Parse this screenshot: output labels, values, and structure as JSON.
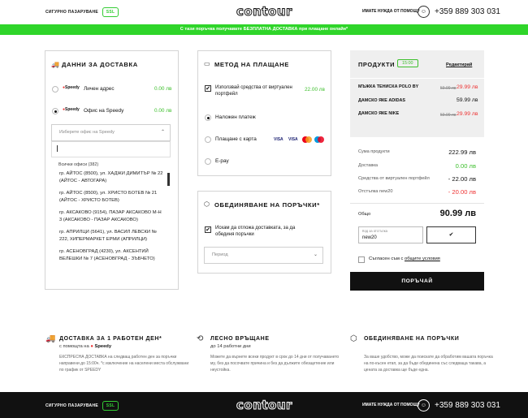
{
  "header": {
    "secure_label": "СИГУРНО ПАЗАРУВАНЕ",
    "secure_badge": "SSL",
    "logo": "contour",
    "help": "ИМАТЕ НУЖДА ОТ ПОМОЩ?",
    "phone": "+359 889 303 031"
  },
  "promo": "С тази поръчка получавате БЕЗПЛАТНА ДОСТАВКА при плащане онлайн*",
  "delivery": {
    "title": "ДАННИ ЗА ДОСТАВКА",
    "options": [
      {
        "carrier": "Speedy",
        "label": "Личен адрес",
        "price": "0.00 лв",
        "selected": false
      },
      {
        "carrier": "Speedy",
        "label": "Офис на Speedy",
        "price": "0.00 лв",
        "selected": true
      }
    ],
    "office_placeholder": "Изберете офис на Speedy",
    "all_offices": "Всички офиси (382)",
    "offices": [
      "гр. АЙТОС (8500), ул. ХАДЖИ ДИМИТЪР № 22 (АЙТОС - АВТОГАРА)",
      "гр. АЙТОС (8500), ул. ХРИСТО БОТЕВ № 21 (АЙТОС - ХРИСТО БОТЕВ)",
      "гр. АКСАКОВО (9154), ПАЗАР АКСАКОВО М-Н 3 (АКСАКОВО - ПАЗАР АКСАКОВО)",
      "гр. АПРИЛЦИ (5641), ул. ВАСИЛ ЛЕВСКИ № 222, ХИПЕРМАРКЕТ ЕРМИ (АПРИЛЦИ)",
      "гр. АСЕНОВГРАД (4230), ул. АКСЕНТИЙ ВЕЛЕШКИ № 7 (АСЕНОВГРАД - ЗЪБЧЕТО)"
    ]
  },
  "payment": {
    "title": "МЕТОД НА ПЛАЩАНЕ",
    "wallet_label": "Използвай средства от виртуален портфейл",
    "wallet_amount": "22.00 лв",
    "methods": [
      {
        "label": "Наложен платеж",
        "selected": true
      },
      {
        "label": "Плащане с карта",
        "selected": false
      },
      {
        "label": "E-pay",
        "selected": false
      }
    ],
    "cards": [
      "VISA",
      "VISA",
      "",
      ""
    ]
  },
  "merge": {
    "title": "ОБЕДИНЯВАНЕ НА ПОРЪЧКИ*",
    "checkbox_label": "Искам да отложа доставката, за да обединя поръчки",
    "period_placeholder": "Период"
  },
  "products": {
    "title": "ПРОДУКТИ",
    "timer": "15:00",
    "edit": "Редактирай",
    "items": [
      {
        "name": "МЪЖКА ТЕНИСКА POLO BY",
        "old_price": "59.99 лв",
        "price": "29.99 лв",
        "sale": true
      },
      {
        "name": "ДАМСКО ЯКЕ ADIDAS",
        "old_price": "",
        "price": "59.99 лв",
        "sale": false
      },
      {
        "name": "ДАМСКО ЯКЕ NIKE",
        "old_price": "59.99 лв",
        "price": "29.99 лв",
        "sale": true
      }
    ]
  },
  "summary": {
    "rows": [
      {
        "label": "Сума продукти",
        "value": "222.99 лв"
      },
      {
        "label": "Доставка",
        "value": "0.00 лв"
      },
      {
        "label": "Средства от виртуален портфейл",
        "value": "- 22.00 лв"
      },
      {
        "label": "Отстъпка new20",
        "value": "- 20.00 лв"
      }
    ],
    "total_label": "Общо",
    "total_value": "90.99 лв",
    "coupon_label": "Код за отстъпка",
    "coupon_value": "new20",
    "coupon_apply": "✔",
    "terms_prefix": "Съгласен съм с",
    "terms_link": "общите условия",
    "order_button": "ПОРЪЧАЙ"
  },
  "features": [
    {
      "icon": "truck-icon",
      "title": "ДОСТАВКА ЗА 1 РАБОТЕН ДЕН*",
      "subtitle": "с помощта на",
      "subtitle_brand": "Speedy",
      "desc": "ЕКСПРЕСНА ДОСТАВКА на следващ работен ден за поръчки направени до 15:00ч. *с изключение на населени места обслужвани по график от SPEEDY"
    },
    {
      "icon": "return-icon",
      "title": "ЛЕСНО ВРЪЩАНЕ",
      "subtitle": "до 14 работни дни",
      "subtitle_brand": "",
      "desc": "Можете да върнете всеки продукт в срок до 14 дни от получаването му, без да посочвате причина и без да дължите обезщетение или неустойка."
    },
    {
      "icon": "merge-icon",
      "title": "ОБЕДИНЯВАНЕ НА ПОРЪЧКИ",
      "subtitle": "",
      "subtitle_brand": "",
      "desc": "За ваше удобство, може да поискате да обработим вашата поръчка на по-късен етап, за да бъде обединена със следваща такава, а цената за доставка ще бъде една."
    }
  ],
  "footer": {
    "secure_label": "СИГУРНО ПАЗАРУВАНЕ",
    "secure_badge": "SSL",
    "logo": "contour",
    "help": "ИМАТЕ НУЖДА ОТ ПОМОЩ?",
    "phone": "+359 889 303 031"
  }
}
